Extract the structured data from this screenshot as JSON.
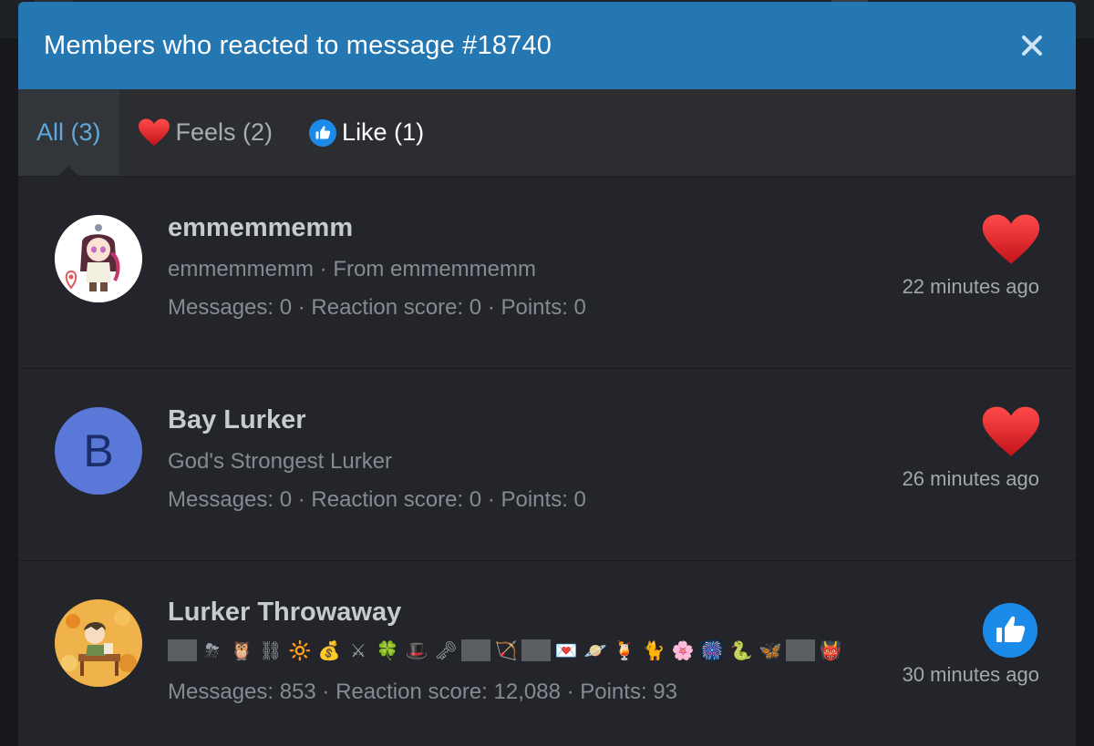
{
  "dialog": {
    "title": "Members who reacted to message #18740",
    "close_icon": "close-icon"
  },
  "tabs": [
    {
      "label": "All (3)",
      "icon": null,
      "active": true
    },
    {
      "label": "Feels (2)",
      "icon": "heart-icon",
      "active": false
    },
    {
      "label": "Like (1)",
      "icon": "thumbs-up-icon",
      "active": false
    }
  ],
  "members": [
    {
      "name": "emmemmemm",
      "subtitle": "emmemmemm · From emmemmemm",
      "stats": "Messages: 0 · Reaction score: 0 · Points: 0",
      "reaction": "heart-icon",
      "time": "22 minutes ago",
      "avatar": "anime-character-avatar"
    },
    {
      "name": "Bay Lurker",
      "subtitle": "God's Strongest Lurker",
      "stats": "Messages: 0 · Reaction score: 0 · Points: 0",
      "reaction": "heart-icon",
      "time": "26 minutes ago",
      "avatar_letter": "B",
      "avatar_color": "#5a78d8"
    },
    {
      "name": "Lurker Throwaway",
      "subtitle_emojis": [
        "■",
        "⛈",
        "🦉",
        "⛓",
        "🔆",
        "💰",
        "⚔",
        "🍀",
        "🎩",
        "🗝",
        "■",
        "🏹",
        "■",
        "💌",
        "🪐",
        "🍹",
        "🐈",
        "🌸",
        "🎆",
        "🐍",
        "🦋",
        "■",
        "👹"
      ],
      "stats": "Messages: 853 · Reaction score: 12,088 · Points: 93",
      "reaction": "thumbs-up-icon",
      "time": "30 minutes ago",
      "avatar": "character-on-bench-avatar"
    }
  ],
  "colors": {
    "header": "#2577b1",
    "accent": "#5fa8dc",
    "heart": "#e0242b",
    "like": "#1b8ae8"
  }
}
